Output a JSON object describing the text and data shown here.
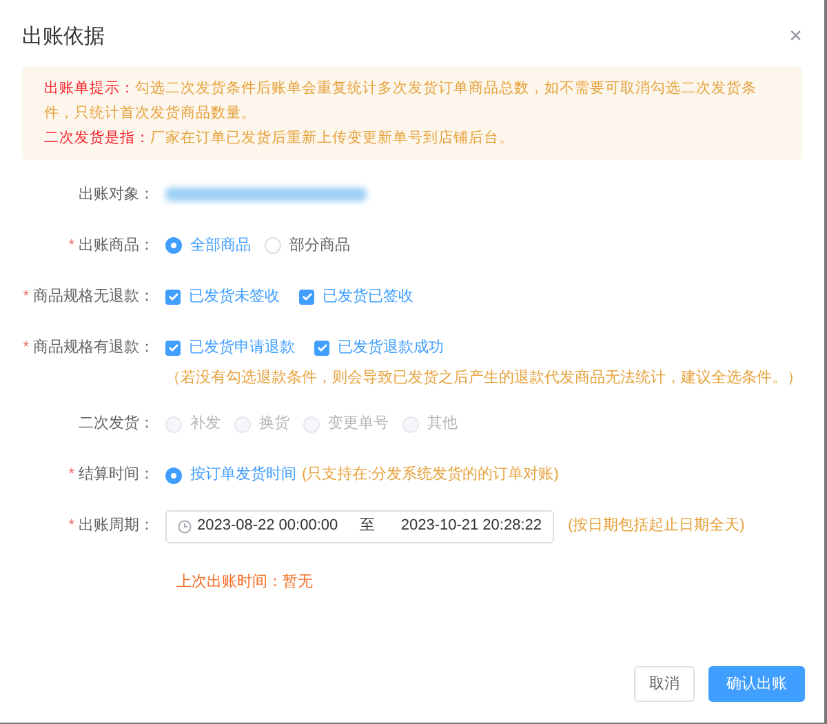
{
  "dialog": {
    "title": "出账依据",
    "close": "×"
  },
  "notice": [
    {
      "label": "出账单提示：",
      "text": "勾选二次发货条件后账单会重复统计多次发货订单商品总数，如不需要可取消勾选二次发货条件，只统计首次发货商品数量。"
    },
    {
      "label": "二次发货是指：",
      "text": "厂家在订单已发货后重新上传变更新单号到店铺后台。"
    }
  ],
  "fields": [
    {
      "kind": "redacted",
      "label": "出账对象："
    },
    {
      "kind": "radio",
      "label": "出账商品：",
      "required_mark": "*",
      "options": [
        {
          "label": "全部商品",
          "selected": true,
          "disabled": false
        },
        {
          "label": "部分商品",
          "selected": false,
          "disabled": false
        }
      ]
    },
    {
      "kind": "checkbox",
      "label": "商品规格无退款：",
      "required_mark": "*",
      "options": [
        {
          "label": "已发货未签收",
          "checked": true
        },
        {
          "label": "已发货已签收",
          "checked": true
        }
      ]
    },
    {
      "kind": "checkbox",
      "label": "商品规格有退款：",
      "required_mark": "*",
      "options": [
        {
          "label": "已发货申请退款",
          "checked": true
        },
        {
          "label": "已发货退款成功",
          "checked": true
        }
      ],
      "note": "（若没有勾选退款条件，则会导致已发货之后产生的退款代发商品无法统计，建议全选条件。）"
    },
    {
      "kind": "radio",
      "label": "二次发货：",
      "options": [
        {
          "label": "补发",
          "selected": false,
          "disabled": true
        },
        {
          "label": "换货",
          "selected": false,
          "disabled": true
        },
        {
          "label": "变更单号",
          "selected": false,
          "disabled": true
        },
        {
          "label": "其他",
          "selected": false,
          "disabled": true
        }
      ]
    },
    {
      "kind": "radio",
      "label": "结算时间：",
      "required_mark": "*",
      "options": [
        {
          "label": "按订单发货时间",
          "selected": true,
          "disabled": false
        }
      ],
      "hint": "(只支持在:分发系统发货的的订单对账)"
    },
    {
      "kind": "daterange",
      "label": "出账周期：",
      "required_mark": "*",
      "start": "2023-08-22 00:00:00",
      "separator": "至",
      "end": "2023-10-21 20:28:22",
      "hint": "(按日期包括起止日期全天)"
    }
  ],
  "last_billing": "上次出账时间：暂无",
  "buttons": [
    {
      "label": "取消",
      "kind": "default"
    },
    {
      "label": "确认出账",
      "kind": "primary"
    }
  ]
}
